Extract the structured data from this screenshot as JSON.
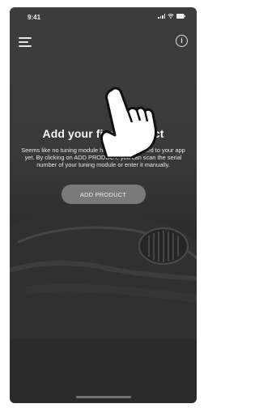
{
  "status": {
    "time": "9:41"
  },
  "screen": {
    "title": "Add your first product",
    "description": "Seems like no tuning module has been connected to your app yet. By clicking on ADD PRODUCT, you can scan the serial number of your tuning module or enter it manually.",
    "add_button_label": "ADD PRODUCT"
  },
  "icons": {
    "menu": "hamburger-menu-icon",
    "info": "info-icon",
    "hand": "tap-hand-icon"
  },
  "colors": {
    "background": "#383838",
    "button": "#7a7a7a",
    "text": "#f5f5f5"
  }
}
